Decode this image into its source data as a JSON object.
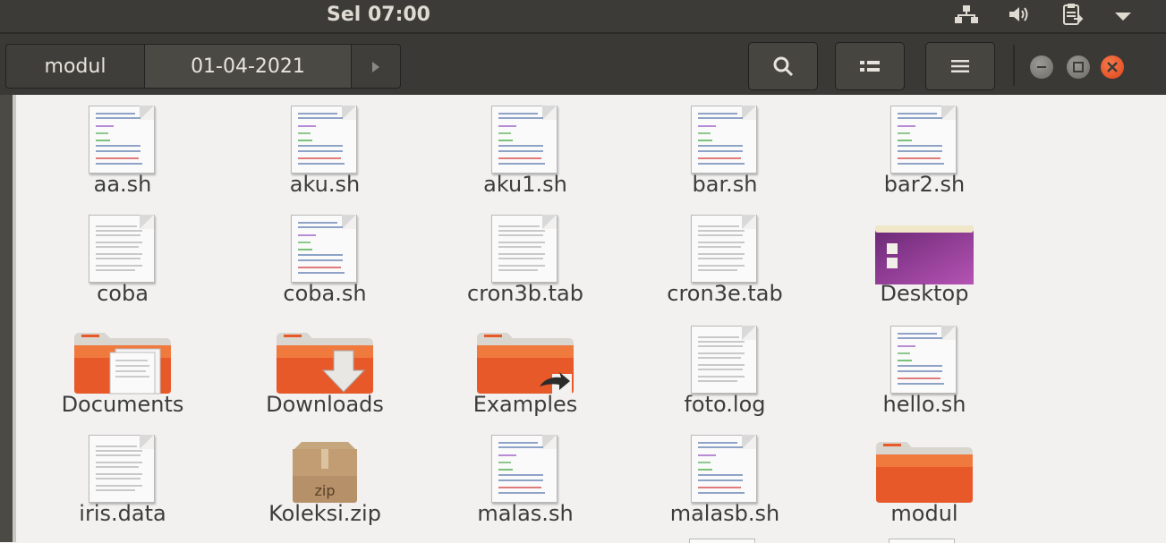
{
  "top_panel": {
    "clock": "Sel 07:00",
    "indicators": [
      "network-icon",
      "volume-icon",
      "clipboard-icon",
      "chevron-down-icon"
    ]
  },
  "header": {
    "breadcrumbs": [
      "modul",
      "01-04-2021"
    ],
    "buttons": [
      "search-icon",
      "view-toggle-icon",
      "menu-icon"
    ],
    "window_controls": [
      "minimize",
      "maximize",
      "close"
    ]
  },
  "files": [
    {
      "name": "aa.sh",
      "icon": "script"
    },
    {
      "name": "aku.sh",
      "icon": "script"
    },
    {
      "name": "aku1.sh",
      "icon": "script"
    },
    {
      "name": "bar.sh",
      "icon": "script"
    },
    {
      "name": "bar2.sh",
      "icon": "script"
    },
    {
      "name": "coba",
      "icon": "text"
    },
    {
      "name": "coba.sh",
      "icon": "script"
    },
    {
      "name": "cron3b.tab",
      "icon": "text"
    },
    {
      "name": "cron3e.tab",
      "icon": "text"
    },
    {
      "name": "Desktop",
      "icon": "desktop-folder"
    },
    {
      "name": "Documents",
      "icon": "documents-folder"
    },
    {
      "name": "Downloads",
      "icon": "downloads-folder"
    },
    {
      "name": "Examples",
      "icon": "examples-folder"
    },
    {
      "name": "foto.log",
      "icon": "text"
    },
    {
      "name": "hello.sh",
      "icon": "script"
    },
    {
      "name": "iris.data",
      "icon": "text"
    },
    {
      "name": "Koleksi.zip",
      "icon": "zip"
    },
    {
      "name": "malas.sh",
      "icon": "script"
    },
    {
      "name": "malasb.sh",
      "icon": "script"
    },
    {
      "name": "modul",
      "icon": "folder"
    }
  ],
  "colors": {
    "panel": "#3c3b37",
    "header": "#3a3935",
    "content_bg": "#f2f1f0",
    "folder_orange": "#e8592a",
    "close_button": "#e95420"
  }
}
